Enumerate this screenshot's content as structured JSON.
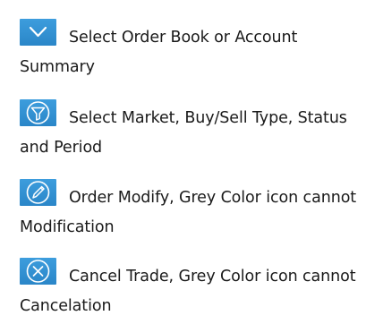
{
  "legend": {
    "items": [
      {
        "icon": "chevron-down-icon",
        "text": "Select Order Book or Account Summary"
      },
      {
        "icon": "filter-icon",
        "text": "Select Market, Buy/Sell Type, Status and Period"
      },
      {
        "icon": "pencil-icon",
        "text": "Order Modify, Grey Color icon cannot Modification"
      },
      {
        "icon": "cancel-icon",
        "text": "Cancel Trade, Grey Color icon cannot Cancelation"
      }
    ]
  },
  "colors": {
    "icon_background": "#2a86c8",
    "icon_foreground": "#ffffff",
    "text": "#1a1a1a"
  }
}
